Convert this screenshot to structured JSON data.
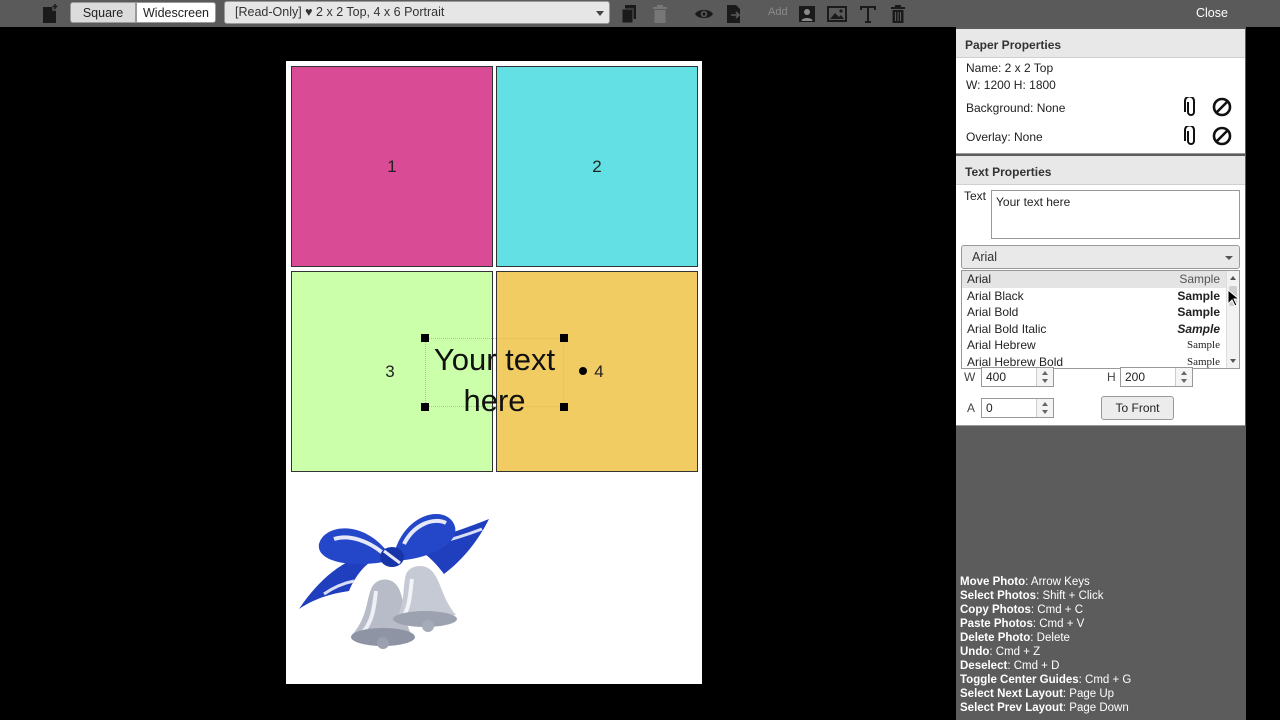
{
  "toolbar": {
    "segments": {
      "square": "Square",
      "widescreen": "Widescreen"
    },
    "layout_select": "[Read-Only] ♥ 2 x 2 Top, 4 x 6 Portrait",
    "add_label": "Add",
    "close": "Close",
    "icons": [
      "new-layout-icon",
      "copy-icon",
      "delete-icon",
      "preview-eye-icon",
      "export-icon",
      "add-photo-slot-icon",
      "add-image-icon",
      "add-text-icon",
      "trash-icon"
    ]
  },
  "paper": {
    "slots": [
      "1",
      "2",
      "3",
      "4"
    ],
    "text_object": "Your text here",
    "image": "wedding-bells-clipart"
  },
  "paper_properties": {
    "title": "Paper Properties",
    "name": "Name: 2 x 2 Top",
    "size": "W: 1200 H: 1800",
    "background": "Background: None",
    "overlay": "Overlay: None"
  },
  "text_properties": {
    "title": "Text Properties",
    "text_label": "Text",
    "text_value": "Your text here",
    "font_selected": "Arial",
    "font_options": [
      {
        "name": "Arial",
        "sample": "Sample"
      },
      {
        "name": "Arial Black",
        "sample": "Sample"
      },
      {
        "name": "Arial Bold",
        "sample": "Sample"
      },
      {
        "name": "Arial Bold Italic",
        "sample": "Sample"
      },
      {
        "name": "Arial Hebrew",
        "sample": "Sample"
      },
      {
        "name": "Arial Hebrew Bold",
        "sample": "Sample"
      }
    ],
    "w_label": "W",
    "w_value": "400",
    "h_label": "H",
    "h_value": "200",
    "a_label": "A",
    "a_value": "0",
    "to_front": "To Front"
  },
  "shortcuts": [
    {
      "key": "Move Photo",
      "value": ": Arrow Keys"
    },
    {
      "key": "Select Photos",
      "value": ": Shift + Click"
    },
    {
      "key": "Copy Photos",
      "value": ": Cmd + C"
    },
    {
      "key": "Paste Photos",
      "value": ": Cmd + V"
    },
    {
      "key": "Delete Photo",
      "value": ": Delete"
    },
    {
      "key": "Undo",
      "value": ": Cmd + Z"
    },
    {
      "key": "Deselect",
      "value": ": Cmd + D"
    },
    {
      "key": "Toggle Center Guides",
      "value": ": Cmd + G"
    },
    {
      "key": "Select Next Layout",
      "value": ": Page Up"
    },
    {
      "key": "Select Prev Layout",
      "value": ": Page Down"
    }
  ],
  "colors": {
    "toolbar": "#5a5a5a",
    "slot1": "#d94b95",
    "slot2": "#62e0e3",
    "slot3": "#ccffaa",
    "slot4": "#f1cc63",
    "bow_blue": "#1f3fbf"
  }
}
